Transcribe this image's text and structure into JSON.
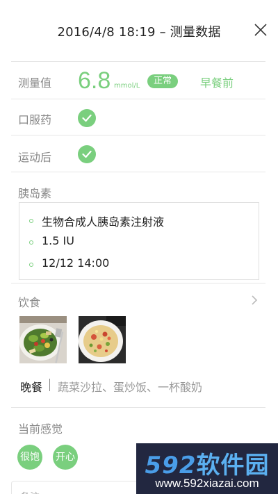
{
  "header": {
    "title": "2016/4/8  18:19 – 测量数据"
  },
  "measurement": {
    "label": "测量值",
    "value": "6.8",
    "unit": "mmol/L",
    "status": "正常",
    "meal_time": "早餐前"
  },
  "medication": {
    "label": "口服药",
    "checked": true
  },
  "exercise": {
    "label": "运动后",
    "checked": true
  },
  "insulin": {
    "label": "胰岛素",
    "items": [
      "生物合成人胰岛素注射液",
      "1.5 IU",
      "12/12  14:00"
    ]
  },
  "diet": {
    "label": "饮食",
    "photos": [
      "salad-photo",
      "fried-rice-photo"
    ],
    "meal_name": "晚餐",
    "foods": "蔬菜沙拉、蛋炒饭、一杯酸奶"
  },
  "feeling": {
    "label": "当前感觉",
    "tags": [
      "很饱",
      "开心"
    ]
  },
  "remark": {
    "label": "备注"
  },
  "watermark": {
    "logo_num": "592",
    "logo_text": "软件园",
    "url": "www.592xiazai.com"
  },
  "colors": {
    "accent": "#7acf7e",
    "divider": "#e6e6e6",
    "label": "#888888"
  }
}
